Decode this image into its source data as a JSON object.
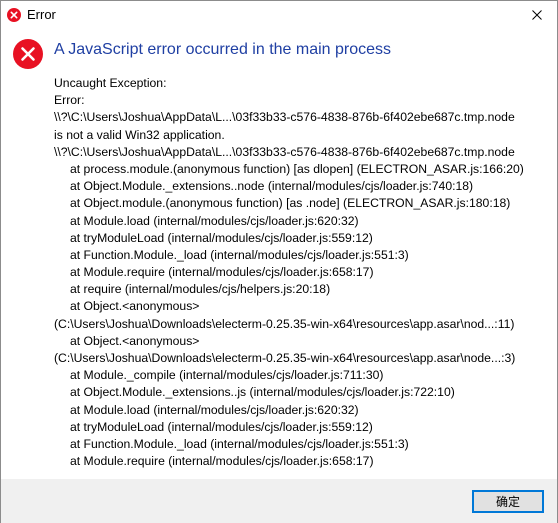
{
  "window": {
    "title": "Error"
  },
  "dialog": {
    "heading": "A JavaScript error occurred in the main process",
    "lines": [
      {
        "text": "Uncaught Exception:",
        "indent": false
      },
      {
        "text": "Error:",
        "indent": false
      },
      {
        "text": "\\\\?\\C:\\Users\\Joshua\\AppData\\L...\\03f33b33-c576-4838-876b-6f402ebe687c.tmp.node",
        "indent": false
      },
      {
        "text": "is not a valid Win32 application.",
        "indent": false
      },
      {
        "text": "\\\\?\\C:\\Users\\Joshua\\AppData\\L...\\03f33b33-c576-4838-876b-6f402ebe687c.tmp.node",
        "indent": false
      },
      {
        "text": "at process.module.(anonymous function) [as dlopen] (ELECTRON_ASAR.js:166:20)",
        "indent": true
      },
      {
        "text": "at Object.Module._extensions..node (internal/modules/cjs/loader.js:740:18)",
        "indent": true
      },
      {
        "text": "at Object.module.(anonymous function) [as .node] (ELECTRON_ASAR.js:180:18)",
        "indent": true
      },
      {
        "text": "at Module.load (internal/modules/cjs/loader.js:620:32)",
        "indent": true
      },
      {
        "text": "at tryModuleLoad (internal/modules/cjs/loader.js:559:12)",
        "indent": true
      },
      {
        "text": "at Function.Module._load (internal/modules/cjs/loader.js:551:3)",
        "indent": true
      },
      {
        "text": "at Module.require (internal/modules/cjs/loader.js:658:17)",
        "indent": true
      },
      {
        "text": "at require (internal/modules/cjs/helpers.js:20:18)",
        "indent": true
      },
      {
        "text": "at Object.<anonymous>",
        "indent": true
      },
      {
        "text": "(C:\\Users\\Joshua\\Downloads\\electerm-0.25.35-win-x64\\resources\\app.asar\\nod...:11)",
        "indent": false
      },
      {
        "text": "at Object.<anonymous>",
        "indent": true
      },
      {
        "text": "(C:\\Users\\Joshua\\Downloads\\electerm-0.25.35-win-x64\\resources\\app.asar\\node...:3)",
        "indent": false
      },
      {
        "text": "at Module._compile (internal/modules/cjs/loader.js:711:30)",
        "indent": true
      },
      {
        "text": "at Object.Module._extensions..js (internal/modules/cjs/loader.js:722:10)",
        "indent": true
      },
      {
        "text": "at Module.load (internal/modules/cjs/loader.js:620:32)",
        "indent": true
      },
      {
        "text": "at tryModuleLoad (internal/modules/cjs/loader.js:559:12)",
        "indent": true
      },
      {
        "text": "at Function.Module._load (internal/modules/cjs/loader.js:551:3)",
        "indent": true
      },
      {
        "text": "at Module.require (internal/modules/cjs/loader.js:658:17)",
        "indent": true
      }
    ]
  },
  "footer": {
    "ok_label": "确定"
  },
  "icons": {
    "title_icon": "error-icon",
    "close": "close-icon",
    "main_icon": "error-icon"
  },
  "colors": {
    "error_red": "#e81123",
    "heading_blue": "#1f3fa3",
    "button_border": "#0078d7"
  }
}
